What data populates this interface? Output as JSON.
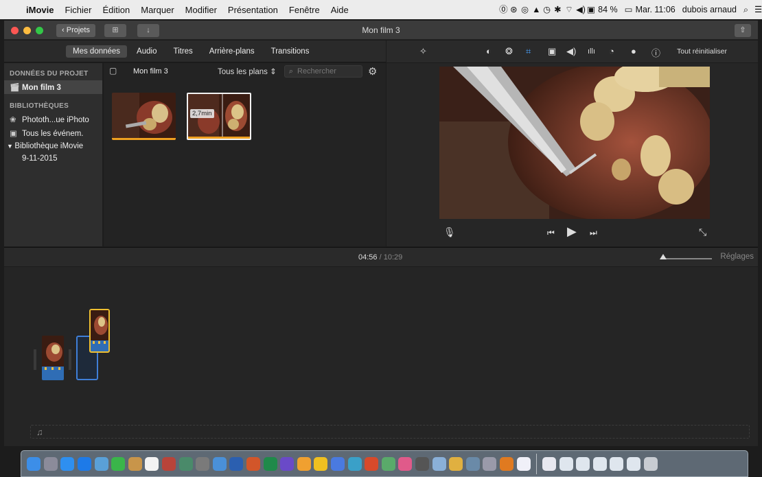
{
  "menubar": {
    "apple_icon": "apple-logo",
    "app_name": "iMovie",
    "items": [
      "Fichier",
      "Édition",
      "Marquer",
      "Modifier",
      "Présentation",
      "Fenêtre",
      "Aide"
    ],
    "battery": "84 %",
    "clock": "Mar. 11:06",
    "user": "dubois arnaud"
  },
  "window": {
    "title": "Mon film 3",
    "projects_button": "Projets"
  },
  "browser_tabs": [
    "Mes données",
    "Audio",
    "Titres",
    "Arrière-plans",
    "Transitions"
  ],
  "sidebar": {
    "project_header": "DONNÉES DU PROJET",
    "project_item": "Mon film 3",
    "libraries_header": "BIBLIOTHÈQUES",
    "library_items": [
      {
        "label": "Phototh...ue iPhoto",
        "icon": "photo-library-icon"
      },
      {
        "label": "Tous les événem.",
        "icon": "events-icon"
      }
    ],
    "imovie_library": "Bibliothèque iMovie",
    "event": "9-11-2015"
  },
  "browser": {
    "project_label": "Mon film 3",
    "filter": "Tous les plans",
    "search_placeholder": "Rechercher",
    "clip_duration_label": "2,7min"
  },
  "inspector": {
    "reset_label": "Tout réinitialiser"
  },
  "timeline": {
    "current": "04:56",
    "separator": "/",
    "total": "10:29",
    "settings_label": "Réglages",
    "zoom_level": 0.0
  }
}
